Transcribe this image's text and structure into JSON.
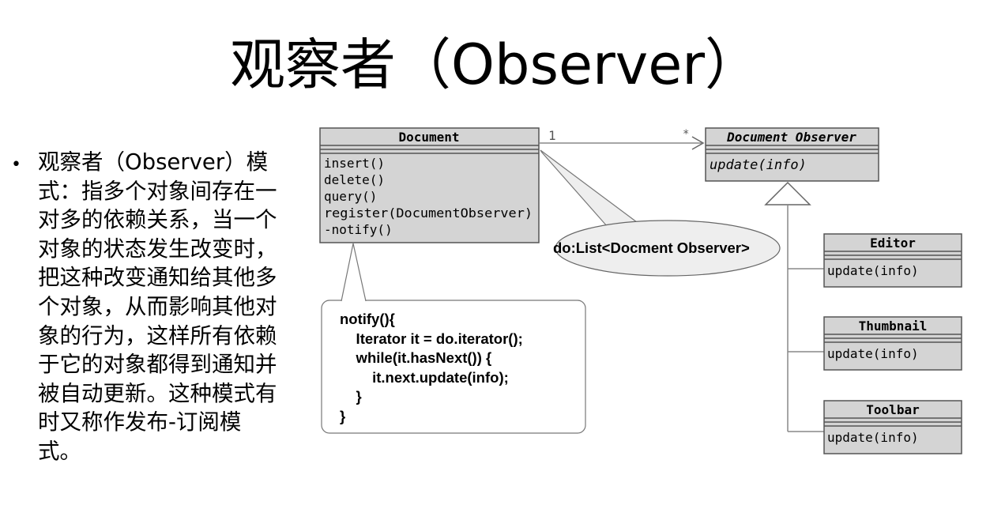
{
  "slide": {
    "title": "观察者（Observer）",
    "bullet": "观察者（Observer）模式：指多个对象间存在一对多的依赖关系，当一个对象的状态发生改变时，把这种改变通知给其他多个对象，从而影响其他对象的行为，这样所有依赖于它的对象都得到通知并被自动更新。这种模式有时又称作发布-订阅模式。"
  },
  "diagram": {
    "document": {
      "name": "Document",
      "methods": [
        "insert()",
        "delete()",
        "query()",
        "register(DocumentObserver)",
        "-notify()"
      ]
    },
    "observer": {
      "name": "Document Observer",
      "methods": [
        "update(info)"
      ]
    },
    "association": {
      "source_mult": "1",
      "target_mult": "*"
    },
    "subclasses": [
      {
        "name": "Editor",
        "method": "update(info)"
      },
      {
        "name": "Thumbnail",
        "method": "update(info)"
      },
      {
        "name": "Toolbar",
        "method": "update(info)"
      }
    ],
    "bubble_note": "do:List<Docment Observer>",
    "code_note": "notify(){\n    Iterator it = do.iterator();\n    while(it.hasNext()) {\n        it.next.update(info);\n    }\n}"
  }
}
